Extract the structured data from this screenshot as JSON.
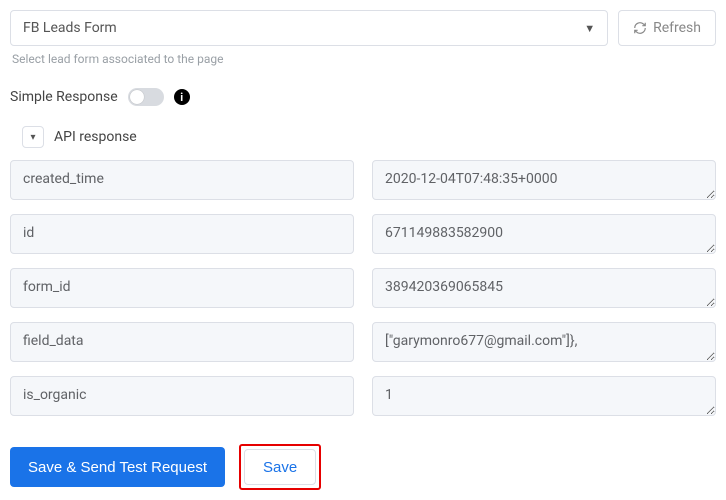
{
  "dropdown": {
    "value": "FB Leads Form"
  },
  "refresh": {
    "label": "Refresh"
  },
  "helper_text": "Select lead form associated to the page",
  "simple_response": {
    "label": "Simple Response",
    "enabled": false
  },
  "section": {
    "title": "API response",
    "rows": [
      {
        "key": "created_time",
        "value": "2020-12-04T07:48:35+0000"
      },
      {
        "key": "id",
        "value": "671149883582900"
      },
      {
        "key": "form_id",
        "value": "389420369065845"
      },
      {
        "key": "field_data",
        "value": "[\"garymonro677@gmail.com\"]},",
        "scroll": true
      },
      {
        "key": "is_organic",
        "value": "1"
      }
    ]
  },
  "actions": {
    "primary": "Save & Send Test Request",
    "save": "Save"
  }
}
